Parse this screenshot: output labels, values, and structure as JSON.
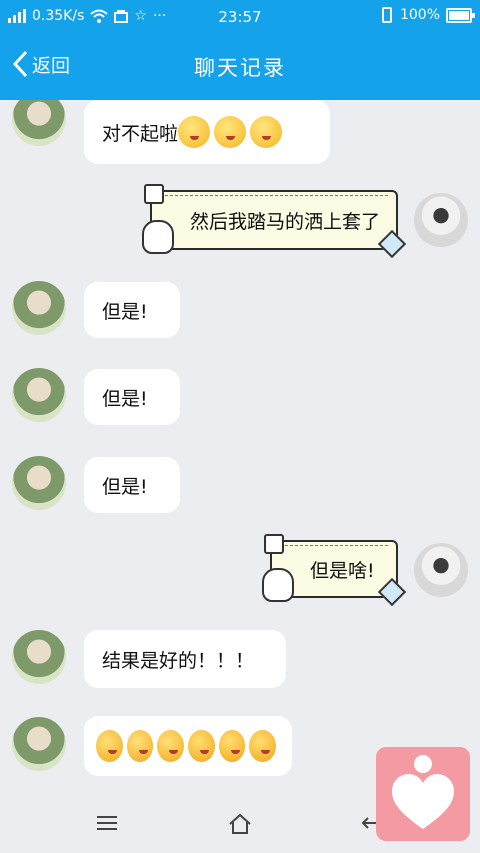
{
  "status_bar": {
    "speed": "0.35K/s",
    "time": "23:57",
    "battery": "100%",
    "battery_level": 1.0
  },
  "title_bar": {
    "back_label": "返回",
    "title": "聊天记录"
  },
  "messages": [
    {
      "side": "left",
      "type": "text",
      "text": "对不起啦",
      "emojis": [
        "grin",
        "grin",
        "grin"
      ]
    },
    {
      "side": "right",
      "type": "note",
      "text": "然后我踏马的洒上套了"
    },
    {
      "side": "left",
      "type": "text",
      "text": "但是!"
    },
    {
      "side": "left",
      "type": "text",
      "text": "但是!"
    },
    {
      "side": "left",
      "type": "text",
      "text": "但是!"
    },
    {
      "side": "right",
      "type": "note",
      "text": "但是啥!"
    },
    {
      "side": "left",
      "type": "text",
      "text": "结果是好的！！！"
    },
    {
      "side": "left",
      "type": "emoji",
      "emojis": [
        "kiss",
        "kiss",
        "kiss",
        "tongue",
        "tongue",
        "tongue"
      ]
    }
  ],
  "nav_bar": {
    "icons": [
      "menu-icon",
      "home-icon",
      "back-arrow-icon"
    ]
  },
  "floating_app": {
    "icon": "heart-person-icon",
    "color": "#f49aa2"
  },
  "colors": {
    "accent": "#14a3ea",
    "background": "#ebedf0",
    "note_bg": "#fcfbe3"
  }
}
